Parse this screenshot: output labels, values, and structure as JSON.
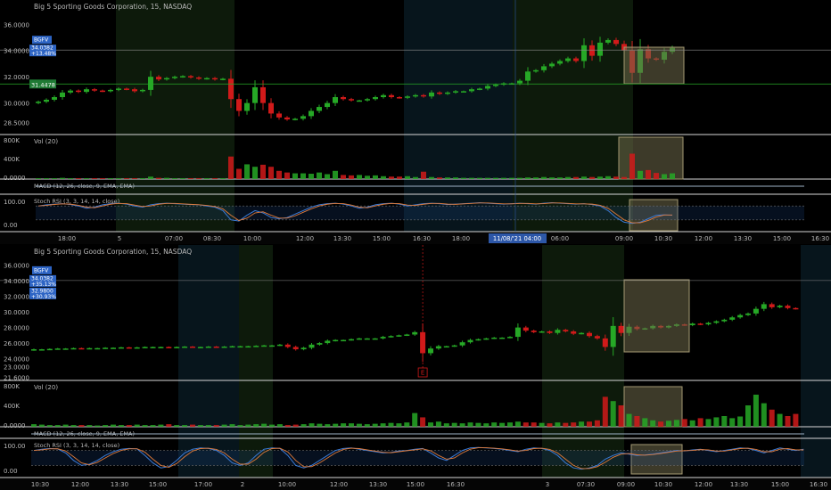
{
  "colors": {
    "background": "#000000",
    "up": "#26a826",
    "down": "#d11a1a",
    "session_green": "#0d1a0b",
    "session_blue": "#07151c",
    "highlight_fill": "#6f6a4a",
    "highlight_stroke": "#a59a73",
    "price_tag_blue": "#2d64c4",
    "price_tag_green": "#1f7a34",
    "separator": "#d8d8d8",
    "text": "#b8b8b8",
    "date_tag": "#2d57a8"
  },
  "chart_data": [
    {
      "type": "candlestick",
      "title": "Big 5 Sporting Goods Corporation, 15, NASDAQ",
      "last_price_label": "34.0382",
      "last_change_label": "+13.48%",
      "ticker_label": "BGFV",
      "green_line_label": "31.4478",
      "y_ticks": [
        "36.0000",
        "34.0000",
        "32.0000",
        "30.0000",
        "28.5000"
      ],
      "volume_label": "Vol (20)",
      "volume_ticks": [
        "800K",
        "400K",
        "0.0000"
      ],
      "macd_label": "MACD (12, 26, close, 9, EMA, EMA)",
      "stoch_label": "Stoch RSI (3, 3, 14, 14, close)",
      "stoch_ticks": [
        "100.00",
        "0.00"
      ],
      "x_ticks": [
        "18:00",
        "5",
        "07:00",
        "08:30",
        "10:00",
        "12:00",
        "13:30",
        "15:00",
        "16:30",
        "18:00",
        "11/08/'21",
        "04:00",
        "06:00",
        "09:00",
        "10:30",
        "12:00",
        "13:30",
        "15:00",
        "16:30"
      ],
      "date_marker_label": "11/08/'21 04:00",
      "close": [
        30.1,
        30.25,
        30.45,
        30.8,
        30.95,
        30.85,
        31.05,
        30.95,
        30.9,
        31.0,
        31.1,
        31.05,
        30.9,
        31.0,
        32.0,
        31.8,
        31.9,
        32.0,
        32.05,
        31.95,
        31.85,
        31.9,
        31.8,
        31.85,
        30.3,
        29.4,
        30.0,
        31.2,
        30.0,
        29.2,
        28.9,
        28.75,
        28.8,
        29.0,
        29.4,
        29.7,
        30.0,
        30.45,
        30.3,
        30.2,
        30.2,
        30.3,
        30.45,
        30.6,
        30.45,
        30.4,
        30.5,
        30.6,
        30.5,
        30.8,
        30.7,
        30.8,
        30.9,
        30.9,
        31.05,
        31.1,
        31.3,
        31.4,
        31.5,
        31.5,
        31.7,
        32.4,
        32.5,
        32.8,
        33.0,
        33.2,
        33.4,
        33.2,
        34.4,
        33.6,
        34.6,
        34.8,
        34.5,
        34.0,
        32.3,
        34.1,
        33.4,
        33.3,
        33.9,
        34.2
      ],
      "volume_pct": [
        0.02,
        0.02,
        0.02,
        0.03,
        0.02,
        0.02,
        0.02,
        0.02,
        0.02,
        0.02,
        0.02,
        0.02,
        0.02,
        0.02,
        0.06,
        0.03,
        0.03,
        0.02,
        0.02,
        0.02,
        0.02,
        0.02,
        0.02,
        0.02,
        0.55,
        0.25,
        0.36,
        0.3,
        0.35,
        0.3,
        0.2,
        0.16,
        0.14,
        0.14,
        0.13,
        0.16,
        0.12,
        0.2,
        0.1,
        0.09,
        0.1,
        0.08,
        0.09,
        0.07,
        0.06,
        0.06,
        0.07,
        0.05,
        0.18,
        0.05,
        0.04,
        0.04,
        0.04,
        0.03,
        0.03,
        0.03,
        0.03,
        0.03,
        0.03,
        0.03,
        0.03,
        0.04,
        0.04,
        0.05,
        0.04,
        0.04,
        0.05,
        0.05,
        0.06,
        0.05,
        0.06,
        0.07,
        0.06,
        0.05,
        0.62,
        0.2,
        0.22,
        0.15,
        0.12,
        0.14
      ],
      "stoch": [
        80,
        85,
        88,
        90,
        86,
        80,
        70,
        75,
        85,
        90,
        92,
        88,
        80,
        75,
        85,
        90,
        92,
        90,
        88,
        86,
        85,
        80,
        75,
        60,
        20,
        15,
        40,
        60,
        50,
        30,
        25,
        30,
        45,
        60,
        75,
        85,
        90,
        92,
        88,
        80,
        70,
        75,
        85,
        90,
        92,
        88,
        80,
        85,
        90,
        92,
        90,
        86,
        88,
        90,
        92,
        94,
        92,
        90,
        88,
        90,
        92,
        90,
        88,
        92,
        94,
        92,
        90,
        88,
        90,
        86,
        80,
        60,
        30,
        10,
        5,
        10,
        25,
        40,
        42,
        40
      ]
    },
    {
      "type": "candlestick",
      "title": "Big 5 Sporting Goods Corporation, 15, NASDAQ",
      "last_price_label": "34.0382",
      "last_change_label": "+35.13%",
      "ticker_label": "BGFV",
      "second_price_label": "32.9800",
      "second_change_label": "+30.93%",
      "y_ticks": [
        "36.0000",
        "34.0000",
        "32.0000",
        "30.0000",
        "28.0000",
        "26.0000",
        "24.0000",
        "23.0000",
        "21.6000"
      ],
      "volume_label": "Vol (20)",
      "volume_ticks": [
        "800K",
        "400K",
        "0.0000"
      ],
      "macd_label": "MACD (12, 26, close, 9, EMA, EMA)",
      "stoch_label": "Stoch RSI (3, 3, 14, 14, close)",
      "stoch_ticks": [
        "100.00",
        "0.00"
      ],
      "x_ticks": [
        "10:30",
        "12:00",
        "13:30",
        "15:00",
        "17:00",
        "2",
        "10:00",
        "12:00",
        "13:30",
        "15:00",
        "16:30",
        "3",
        "07:30",
        "09:00",
        "10:30",
        "12:00",
        "13:30",
        "15:00",
        "16:30"
      ],
      "earnings_marker": "E",
      "close": [
        25.2,
        25.2,
        25.25,
        25.3,
        25.3,
        25.35,
        25.3,
        25.35,
        25.35,
        25.4,
        25.4,
        25.45,
        25.4,
        25.45,
        25.5,
        25.5,
        25.5,
        25.45,
        25.5,
        25.55,
        25.5,
        25.5,
        25.55,
        25.5,
        25.55,
        25.6,
        25.6,
        25.6,
        25.65,
        25.7,
        25.7,
        25.8,
        25.5,
        25.2,
        25.4,
        25.8,
        26.0,
        26.3,
        26.4,
        26.4,
        26.5,
        26.6,
        26.6,
        26.6,
        26.8,
        26.9,
        27.0,
        27.1,
        27.4,
        24.7,
        25.3,
        25.6,
        25.6,
        25.7,
        26.1,
        26.4,
        26.5,
        26.6,
        26.7,
        26.7,
        26.8,
        28.0,
        27.6,
        27.4,
        27.5,
        27.3,
        27.7,
        27.5,
        27.2,
        27.3,
        26.9,
        26.6,
        25.5,
        28.2,
        27.3,
        28.1,
        27.8,
        27.9,
        28.2,
        28.0,
        28.2,
        28.4,
        28.3,
        28.5,
        28.4,
        28.6,
        28.8,
        29.0,
        29.3,
        29.6,
        29.8,
        30.4,
        31.0,
        30.6,
        30.8,
        30.5,
        30.4,
        30.9,
        31.8,
        31.5,
        31.4
      ],
      "volume_pct": [
        0.06,
        0.05,
        0.04,
        0.04,
        0.05,
        0.04,
        0.04,
        0.04,
        0.03,
        0.04,
        0.05,
        0.04,
        0.04,
        0.05,
        0.04,
        0.04,
        0.05,
        0.06,
        0.04,
        0.04,
        0.05,
        0.04,
        0.04,
        0.04,
        0.05,
        0.06,
        0.04,
        0.05,
        0.06,
        0.07,
        0.05,
        0.06,
        0.04,
        0.05,
        0.06,
        0.08,
        0.07,
        0.06,
        0.07,
        0.08,
        0.08,
        0.07,
        0.06,
        0.07,
        0.08,
        0.09,
        0.08,
        0.1,
        0.32,
        0.22,
        0.1,
        0.12,
        0.08,
        0.09,
        0.08,
        0.1,
        0.09,
        0.08,
        0.1,
        0.09,
        0.1,
        0.12,
        0.1,
        0.1,
        0.09,
        0.08,
        0.1,
        0.09,
        0.1,
        0.12,
        0.12,
        0.15,
        0.7,
        0.6,
        0.5,
        0.3,
        0.25,
        0.2,
        0.15,
        0.12,
        0.14,
        0.16,
        0.18,
        0.15,
        0.2,
        0.18,
        0.22,
        0.25,
        0.2,
        0.24,
        0.5,
        0.75,
        0.55,
        0.4,
        0.3,
        0.25,
        0.3,
        0.2,
        0.15,
        0.12,
        0.1
      ],
      "stoch": [
        80,
        85,
        88,
        86,
        70,
        40,
        20,
        25,
        40,
        60,
        75,
        85,
        88,
        86,
        60,
        30,
        10,
        15,
        40,
        70,
        85,
        90,
        88,
        80,
        60,
        30,
        20,
        30,
        60,
        85,
        90,
        88,
        60,
        20,
        10,
        20,
        40,
        60,
        80,
        88,
        90,
        85,
        80,
        75,
        70,
        72,
        78,
        80,
        85,
        88,
        70,
        50,
        40,
        60,
        80,
        90,
        92,
        90,
        88,
        85,
        80,
        75,
        85,
        90,
        88,
        80,
        60,
        30,
        10,
        5,
        10,
        20,
        45,
        60,
        70,
        65,
        60,
        62,
        65,
        70,
        75,
        80,
        78,
        82,
        85,
        80,
        75,
        80,
        85,
        90,
        88,
        80,
        70,
        80,
        90,
        85,
        80,
        85,
        90,
        75,
        80
      ]
    }
  ]
}
